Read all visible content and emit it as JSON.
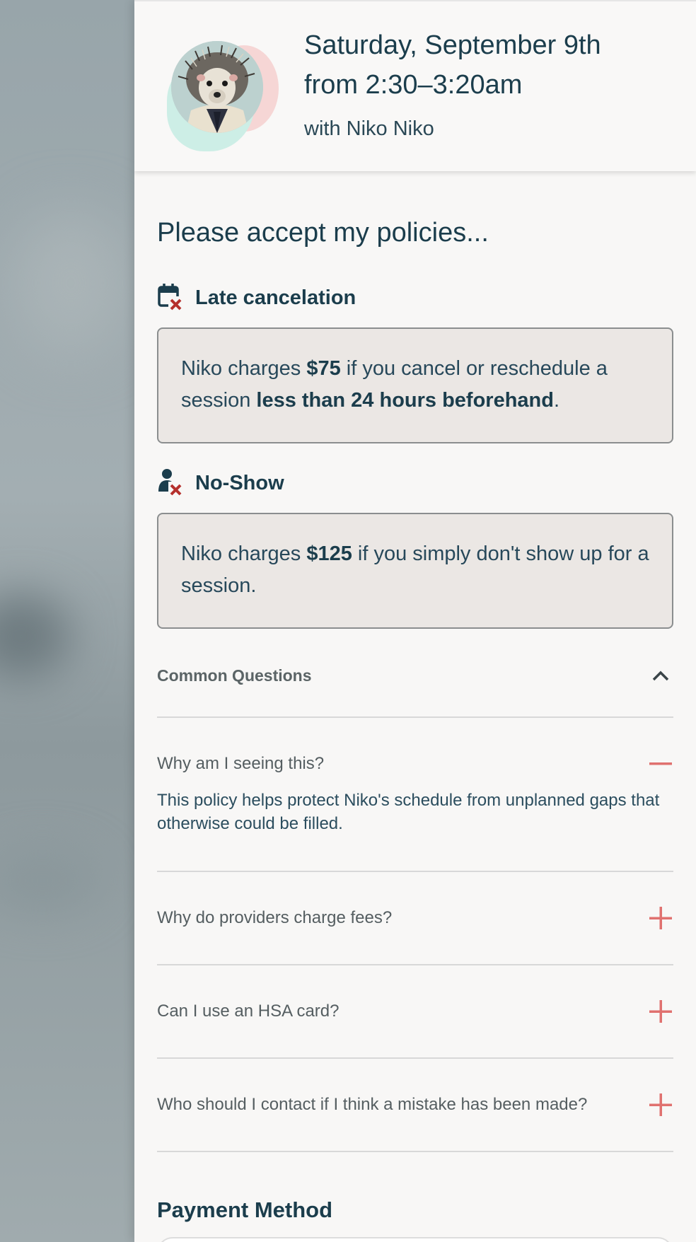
{
  "appointment": {
    "title": "Saturday, September 9th from 2:30–3:20am",
    "with": "with Niko Niko"
  },
  "policies": {
    "heading": "Please accept my policies...",
    "late": {
      "label": "Late cancelation",
      "text_pre": "Niko charges ",
      "amount": "$75",
      "text_mid": " if you cancel or reschedule a session ",
      "emphasis": "less than 24 hours beforehand",
      "text_post": "."
    },
    "noshow": {
      "label": "No-Show",
      "text_pre": "Niko charges ",
      "amount": "$125",
      "text_post": " if you simply don't show up for a session."
    }
  },
  "faq": {
    "heading": "Common Questions",
    "items": [
      {
        "q": "Why am I seeing this?",
        "a": "This policy helps protect Niko's schedule from unplanned gaps that otherwise could be filled.",
        "open": true
      },
      {
        "q": "Why do providers charge fees?",
        "open": false
      },
      {
        "q": "Can I use an HSA card?",
        "open": false
      },
      {
        "q": "Who should I contact if I think a mistake has been made?",
        "open": false
      }
    ]
  },
  "payment": {
    "heading": "Payment Method"
  },
  "colors": {
    "navy": "#1b3d4c",
    "accent_red": "#e0716f",
    "icon_red": "#b5302c"
  },
  "icons": {
    "late": "calendar-x-icon",
    "noshow": "person-x-icon",
    "collapse": "chevron-up-icon",
    "open": "minus-icon",
    "closed": "plus-icon"
  }
}
